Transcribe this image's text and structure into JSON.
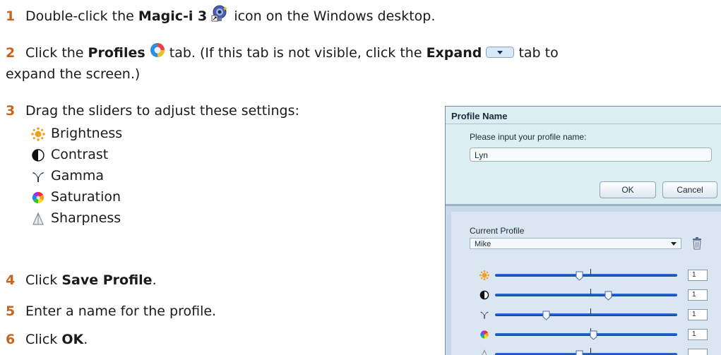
{
  "steps": [
    {
      "num": "1",
      "pre": "Double-click the ",
      "bold": "Magic-i 3",
      "post": " icon on the Windows desktop."
    },
    {
      "num": "2",
      "pre": "Click the ",
      "bold": "Profiles",
      "mid": " tab. (If this tab is not visible, click the ",
      "bold2": "Expand",
      "post": " tab to",
      "cont": "expand the screen.)"
    },
    {
      "num": "3",
      "text": "Drag the sliders to adjust these settings:"
    },
    {
      "num": "4",
      "pre": "Click ",
      "bold": "Save Profile",
      "post": "."
    },
    {
      "num": "5",
      "text": "Enter a name for the profile."
    },
    {
      "num": "6",
      "pre": "Click ",
      "bold": "OK",
      "post": "."
    }
  ],
  "settings": [
    {
      "label": "Brightness",
      "icon": "brightness-sun-icon"
    },
    {
      "label": "Contrast",
      "icon": "contrast-half-circle-icon"
    },
    {
      "label": "Gamma",
      "icon": "gamma-icon"
    },
    {
      "label": "Saturation",
      "icon": "saturation-color-wheel-icon"
    },
    {
      "label": "Sharpness",
      "icon": "sharpness-triangle-icon"
    }
  ],
  "dialog": {
    "title": "Profile Name",
    "prompt": "Please input your profile name:",
    "input_value": "Lyn",
    "ok_label": "OK",
    "cancel_label": "Cancel",
    "current_profile_label": "Current Profile",
    "current_profile_value": "Mike",
    "sliders": [
      {
        "icon": "brightness-sun-icon",
        "value": "1",
        "position": 0.46
      },
      {
        "icon": "contrast-half-circle-icon",
        "value": "1",
        "position": 0.62
      },
      {
        "icon": "gamma-icon",
        "value": "1",
        "position": 0.28
      },
      {
        "icon": "saturation-color-wheel-icon",
        "value": "1",
        "position": 0.54
      },
      {
        "icon": "sharpness-triangle-icon",
        "value": "",
        "position": 0.46
      }
    ]
  },
  "colors": {
    "step_number": "#c8641e",
    "slider_track": "#1f5fc4",
    "dialog_top": "#dceef2",
    "dialog_bottom": "#dbe6f3"
  }
}
